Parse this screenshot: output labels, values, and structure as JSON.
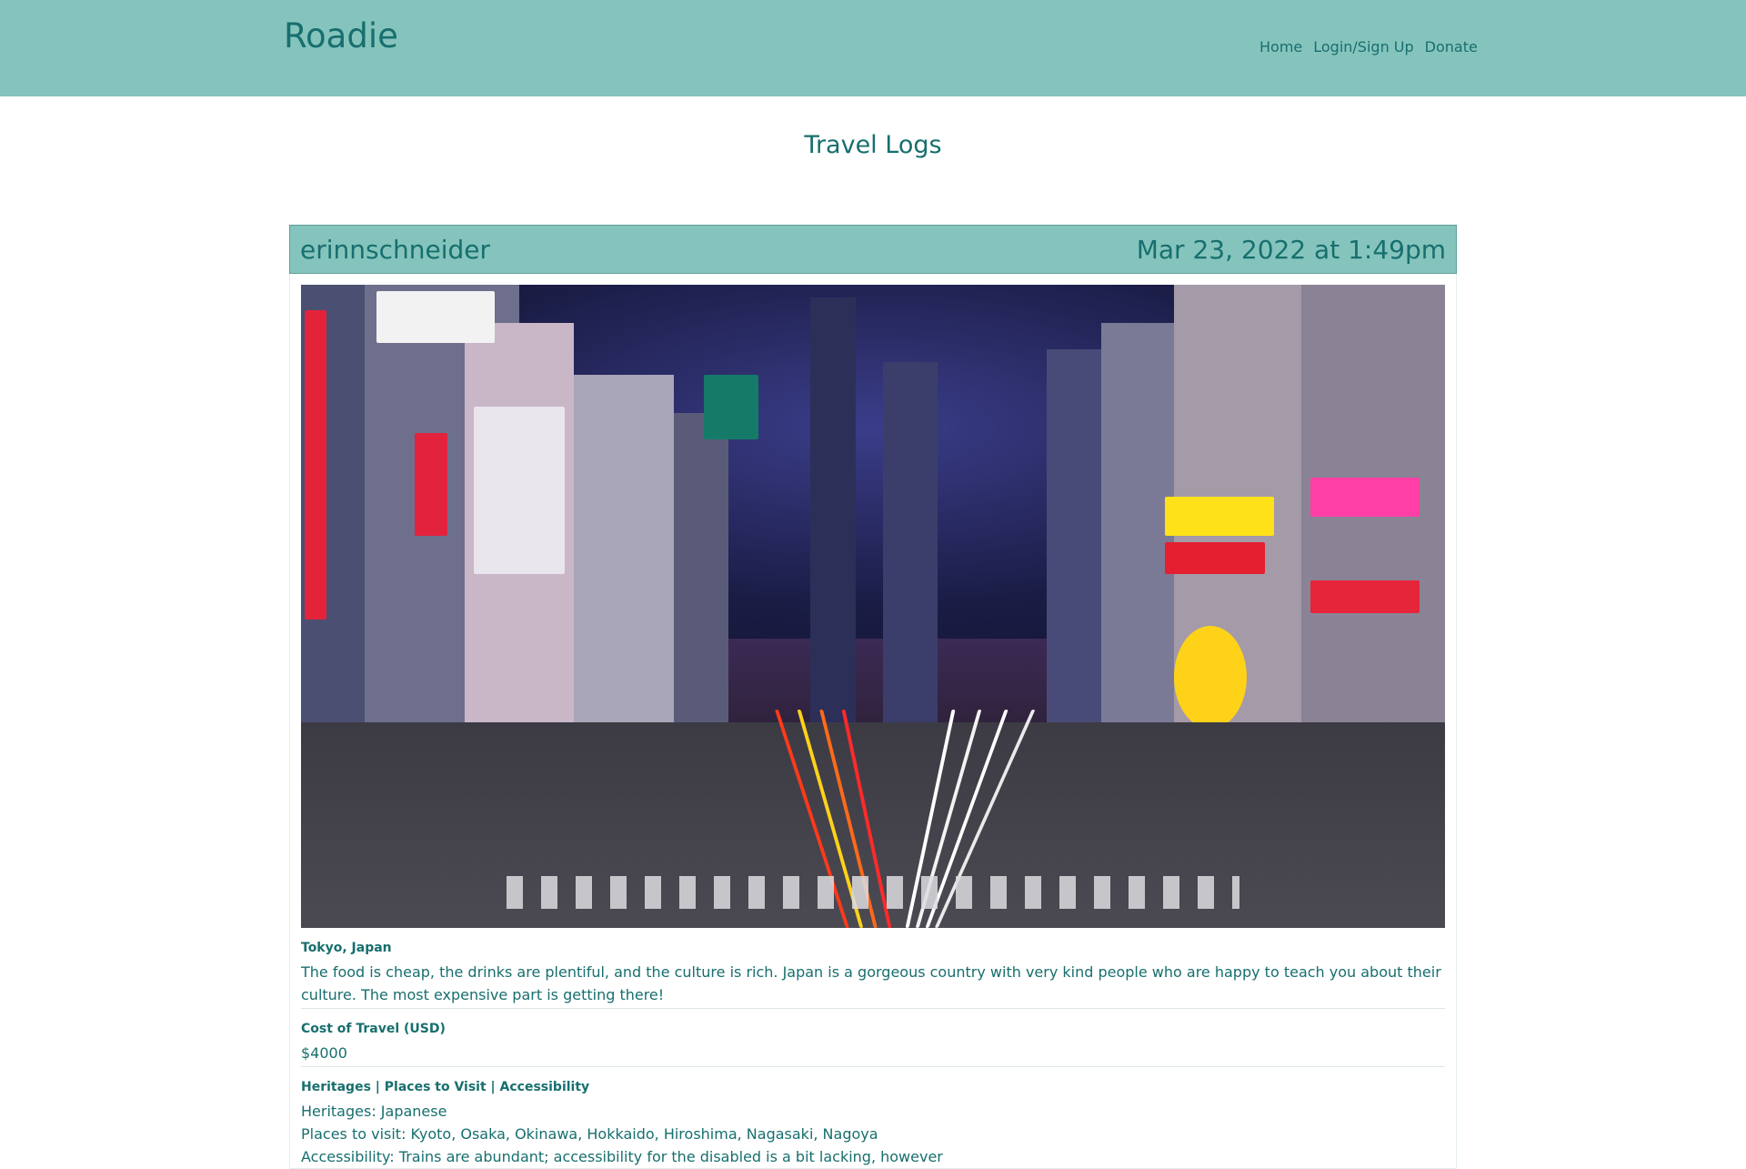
{
  "navbar": {
    "brand": "Roadie",
    "links": [
      "Home",
      "Login/Sign Up",
      "Donate"
    ]
  },
  "page_title": "Travel Logs",
  "log": {
    "username": "erinnschneider",
    "timestamp": "Mar 23, 2022 at 1:49pm",
    "location": "Tokyo, Japan",
    "description": "The food is cheap, the drinks are plentiful, and the culture is rich. Japan is a gorgeous country with very kind people who are happy to teach you about their culture. The most expensive part is getting there!",
    "cost_label": "Cost of Travel (USD)",
    "cost_value": "$4000",
    "details_label": "Heritages | Places to Visit | Accessibility",
    "heritages": "Heritages: Japanese",
    "places": "Places to visit: Kyoto, Osaka, Okinawa, Hokkaido, Hiroshima, Nagasaki, Nagoya",
    "accessibility": "Accessibility: Trains are abundant; accessibility for the disabled is a bit lacking, however"
  },
  "colors": {
    "navbar_bg": "#85c4bd",
    "text": "#176f6e"
  }
}
